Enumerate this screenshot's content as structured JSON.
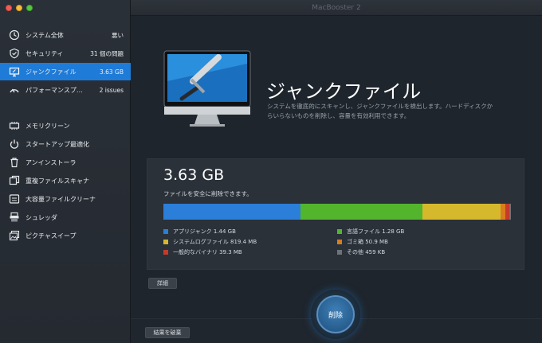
{
  "window": {
    "title": "MacBooster 2"
  },
  "colors": {
    "accent": "#1f7bd8",
    "app_junk": "#2b7fd9",
    "language": "#52b52b",
    "syslog": "#d6b82d",
    "trash": "#d97d1e",
    "binary": "#c63a2c",
    "other": "#6d7379"
  },
  "sidebar": {
    "items": [
      {
        "icon": "monitor-icon",
        "label": "システム全体",
        "value": "悪い"
      },
      {
        "icon": "shield-icon",
        "label": "セキュリティ",
        "value": "31 個の問題"
      },
      {
        "icon": "display-icon",
        "label": "ジャンクファイル",
        "value": "3.63 GB",
        "active": true
      },
      {
        "icon": "speedometer-icon",
        "label": "パフォーマンスプ…",
        "value": "2 issues"
      },
      {
        "icon": "memory-icon",
        "label": "メモリクリーン"
      },
      {
        "icon": "power-icon",
        "label": "スタートアップ最適化"
      },
      {
        "icon": "trash-icon",
        "label": "アンインストーラ"
      },
      {
        "icon": "duplicate-icon",
        "label": "重複ファイルスキャナ"
      },
      {
        "icon": "large-file-icon",
        "label": "大容量ファイルクリーナ"
      },
      {
        "icon": "shredder-icon",
        "label": "シュレッダ"
      },
      {
        "icon": "picture-icon",
        "label": "ピクチャスイープ"
      }
    ]
  },
  "hero": {
    "title": "ジャンクファイル",
    "description": "システムを徹底的にスキャンし、ジャンクファイルを検出します。ハードディスクからいらないものを削除し、容量を有効利用できます。"
  },
  "summary": {
    "size": "3.63 GB",
    "subtitle": "ファイルを安全に削除できます。"
  },
  "breakdown": [
    {
      "label": "アプリジャンク 1.44 GB",
      "color": "#2b7fd9",
      "fraction": 0.397
    },
    {
      "label": "言語ファイル 1.28 GB",
      "color": "#52b52b",
      "fraction": 0.353
    },
    {
      "label": "システムログファイル 819.4 MB",
      "color": "#d6b82d",
      "fraction": 0.226
    },
    {
      "label": "ゴミ箱 50.9 MB",
      "color": "#d97d1e",
      "fraction": 0.014
    },
    {
      "label": "一般的なバイナリ 39.3 MB",
      "color": "#c63a2c",
      "fraction": 0.011
    },
    {
      "label": "その他 459 KB",
      "color": "#6d7379",
      "fraction": 0.001
    }
  ],
  "buttons": {
    "details": "詳細",
    "discard": "結果を破棄",
    "delete": "削除"
  }
}
